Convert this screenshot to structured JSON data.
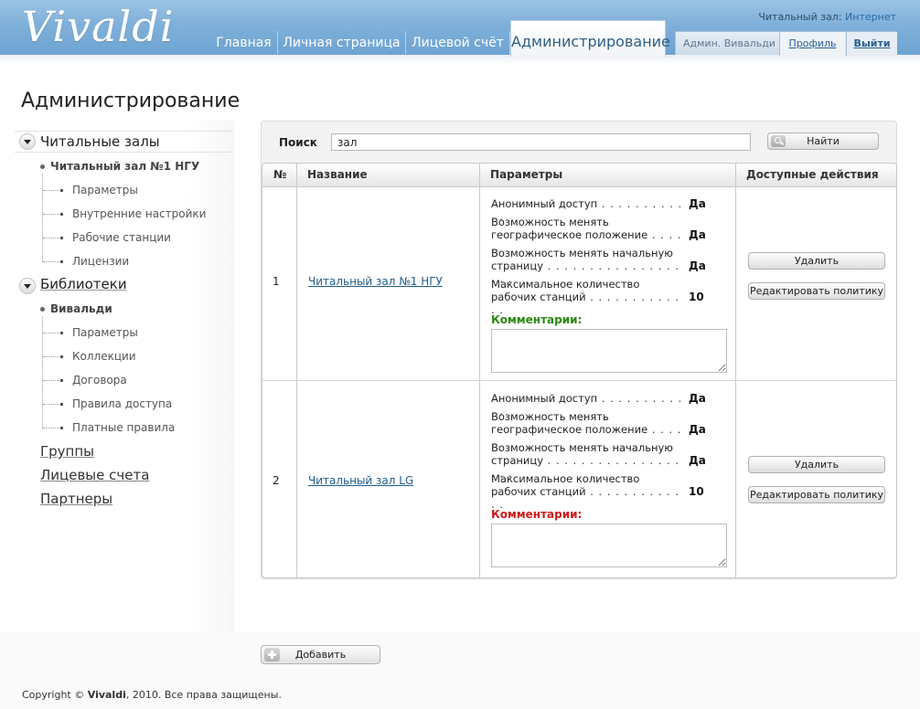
{
  "header": {
    "logo": "Vivaldi",
    "tabs": [
      "Главная",
      "Личная страница",
      "Лицевой счёт",
      "Администрирование"
    ],
    "hall_prefix": "Читальный зал: ",
    "hall_value": "Интернет",
    "user": "Админ. Вивальди ↦",
    "profile": "Профиль",
    "exit": "Выйти"
  },
  "page_title": "Администрирование",
  "sidebar": {
    "reading_halls": "Читальные залы",
    "hall_item": "Читальный зал №1 НГУ",
    "hall_subitems": [
      "Параметры",
      "Внутренние настройки",
      "Рабочие станции",
      "Лицензии"
    ],
    "libraries": "Библиотеки",
    "library_item": "Вивальди",
    "library_subitems": [
      "Параметры",
      "Коллекции",
      "Договора",
      "Правила доступа",
      "Платные правила"
    ],
    "links": [
      "Группы",
      "Лицевые счета",
      "Партнеры"
    ]
  },
  "search": {
    "label": "Поиск",
    "value": "зал",
    "button": "Найти"
  },
  "table": {
    "headers": [
      "№",
      "Название",
      "Параметры",
      "Доступные действия"
    ],
    "rows": [
      {
        "num": "1",
        "name": "Читальный зал №1 НГУ",
        "params": [
          {
            "name": "Анонимный доступ",
            "dots": " . . . . . . . . . . . .",
            "value": "Да"
          },
          {
            "name_l1": "Возможность менять",
            "name_l2": "географическое положение",
            "dots": " . . . . .",
            "value": "Да"
          },
          {
            "name_l1": "Возможность менять начальную",
            "name_l2": "страницу",
            "dots": " . . . . . . . . . . . . . . . . . . .",
            "value": "Да"
          },
          {
            "name_l1": "Максимальное количество",
            "name_l2": "рабочих станций",
            "dots": "  . . . . . . . . . . . . .",
            "value": "10"
          }
        ],
        "comment_label": "Комментарии:",
        "comment_color": "#2a8a12",
        "actions": [
          "Удалить",
          "Редактировать политику"
        ]
      },
      {
        "num": "2",
        "name": "Читальный зал LG",
        "params": [
          {
            "name": "Анонимный доступ",
            "dots": " . . . . . . . . . . . .",
            "value": "Да"
          },
          {
            "name_l1": "Возможность менять",
            "name_l2": "географическое положение",
            "dots": " . . . . .",
            "value": "Да"
          },
          {
            "name_l1": "Возможность менять начальную",
            "name_l2": "страницу",
            "dots": " . . . . . . . . . . . . . . . . . . .",
            "value": "Да"
          },
          {
            "name_l1": "Максимальное количество",
            "name_l2": "рабочих станций",
            "dots": "  . . . . . . . . . . . . .",
            "value": "10"
          }
        ],
        "comment_label": "Комментарии:",
        "comment_color": "#cc1a1a",
        "actions": [
          "Удалить",
          "Редактировать политику"
        ]
      }
    ]
  },
  "add_button": "Добавить",
  "footer": {
    "prefix": "Copyright © ",
    "brand": "Vivaldi",
    "suffix": ", 2010. Все права защищены."
  }
}
